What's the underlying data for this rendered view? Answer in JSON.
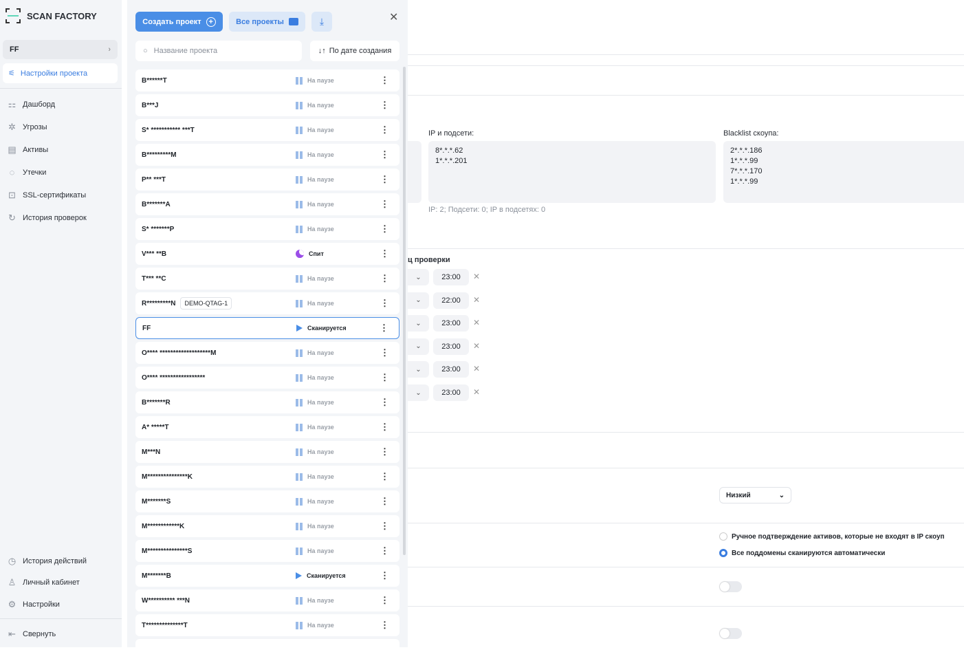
{
  "app": {
    "name": "SCAN FACTORY"
  },
  "sidebar": {
    "project": "FF",
    "project_settings": "Настройки проекта",
    "items": [
      {
        "label": "Дашборд",
        "icon": "grid-icon"
      },
      {
        "label": "Угрозы",
        "icon": "bug-icon"
      },
      {
        "label": "Активы",
        "icon": "archive-icon"
      },
      {
        "label": "Утечки",
        "icon": "drop-icon"
      },
      {
        "label": "SSL-сертификаты",
        "icon": "lock-icon"
      },
      {
        "label": "История проверок",
        "icon": "history-icon"
      }
    ],
    "bottom": [
      {
        "label": "История действий",
        "icon": "clock-icon"
      },
      {
        "label": "Личный кабинет",
        "icon": "user-icon"
      },
      {
        "label": "Настройки",
        "icon": "gear-icon"
      }
    ],
    "collapse": "Свернуть"
  },
  "panel": {
    "create": "Создать проект",
    "all": "Все проекты",
    "search_placeholder": "Название проекта",
    "sort": "По дате создания",
    "projects": [
      {
        "name": "B******T",
        "status": "На паузе",
        "type": "pause"
      },
      {
        "name": "B***J",
        "status": "На паузе",
        "type": "pause"
      },
      {
        "name": "S* *********** ***T",
        "status": "На паузе",
        "type": "pause"
      },
      {
        "name": "B*********M",
        "status": "На паузе",
        "type": "pause"
      },
      {
        "name": "P** ***T",
        "status": "На паузе",
        "type": "pause"
      },
      {
        "name": "B*******A",
        "status": "На паузе",
        "type": "pause"
      },
      {
        "name": "S* *******P",
        "status": "На паузе",
        "type": "pause"
      },
      {
        "name": "V*** **B",
        "status": "Спит",
        "type": "sleep"
      },
      {
        "name": "T*** **C",
        "status": "На паузе",
        "type": "pause"
      },
      {
        "name": "R*********N",
        "tag": "DEMO-QTAG-1",
        "status": "На паузе",
        "type": "pause"
      },
      {
        "name": "FF",
        "status": "Сканируется",
        "type": "scan",
        "selected": true
      },
      {
        "name": "O**** *******************M",
        "status": "На паузе",
        "type": "pause"
      },
      {
        "name": "O**** *****************",
        "status": "На паузе",
        "type": "pause"
      },
      {
        "name": "B*******R",
        "status": "На паузе",
        "type": "pause"
      },
      {
        "name": "A* *****T",
        "status": "На паузе",
        "type": "pause"
      },
      {
        "name": "M***N",
        "status": "На паузе",
        "type": "pause"
      },
      {
        "name": "M***************K",
        "status": "На паузе",
        "type": "pause"
      },
      {
        "name": "M*******S",
        "status": "На паузе",
        "type": "pause"
      },
      {
        "name": "M************K",
        "status": "На паузе",
        "type": "pause"
      },
      {
        "name": "M***************S",
        "status": "На паузе",
        "type": "pause"
      },
      {
        "name": "M*******B",
        "status": "Сканируется",
        "type": "scan"
      },
      {
        "name": "W********** ***N",
        "status": "На паузе",
        "type": "pause"
      },
      {
        "name": "T**************T",
        "status": "На паузе",
        "type": "pause"
      }
    ]
  },
  "main": {
    "ip_label": "IP и подсети:",
    "ip_value": "8*.*.*.62\n1*.*.*.201",
    "ip_stats": "IP: 2; Подсети: 0; IP в подсетях: 0",
    "blacklist_label": "Blacklist скоупа:",
    "blacklist_value": "2*.*.*.186\n1*.*.*.99\n7*.*.*.170\n1*.*.*.99",
    "schedule_label": "ц проверки",
    "times": [
      "23:00",
      "22:00",
      "23:00",
      "23:00",
      "23:00",
      "23:00"
    ],
    "level": "Низкий",
    "radio": [
      {
        "label": "Ручное подтверждение активов, которые не входят в IP скоуп",
        "checked": false
      },
      {
        "label": "Все поддомены сканируются автоматически",
        "checked": true
      }
    ],
    "toggles": [
      false,
      false
    ]
  },
  "colors": {
    "accent": "#4a8ee6",
    "sleep": "#9b4ee8",
    "pause": "#9bbbe8"
  }
}
